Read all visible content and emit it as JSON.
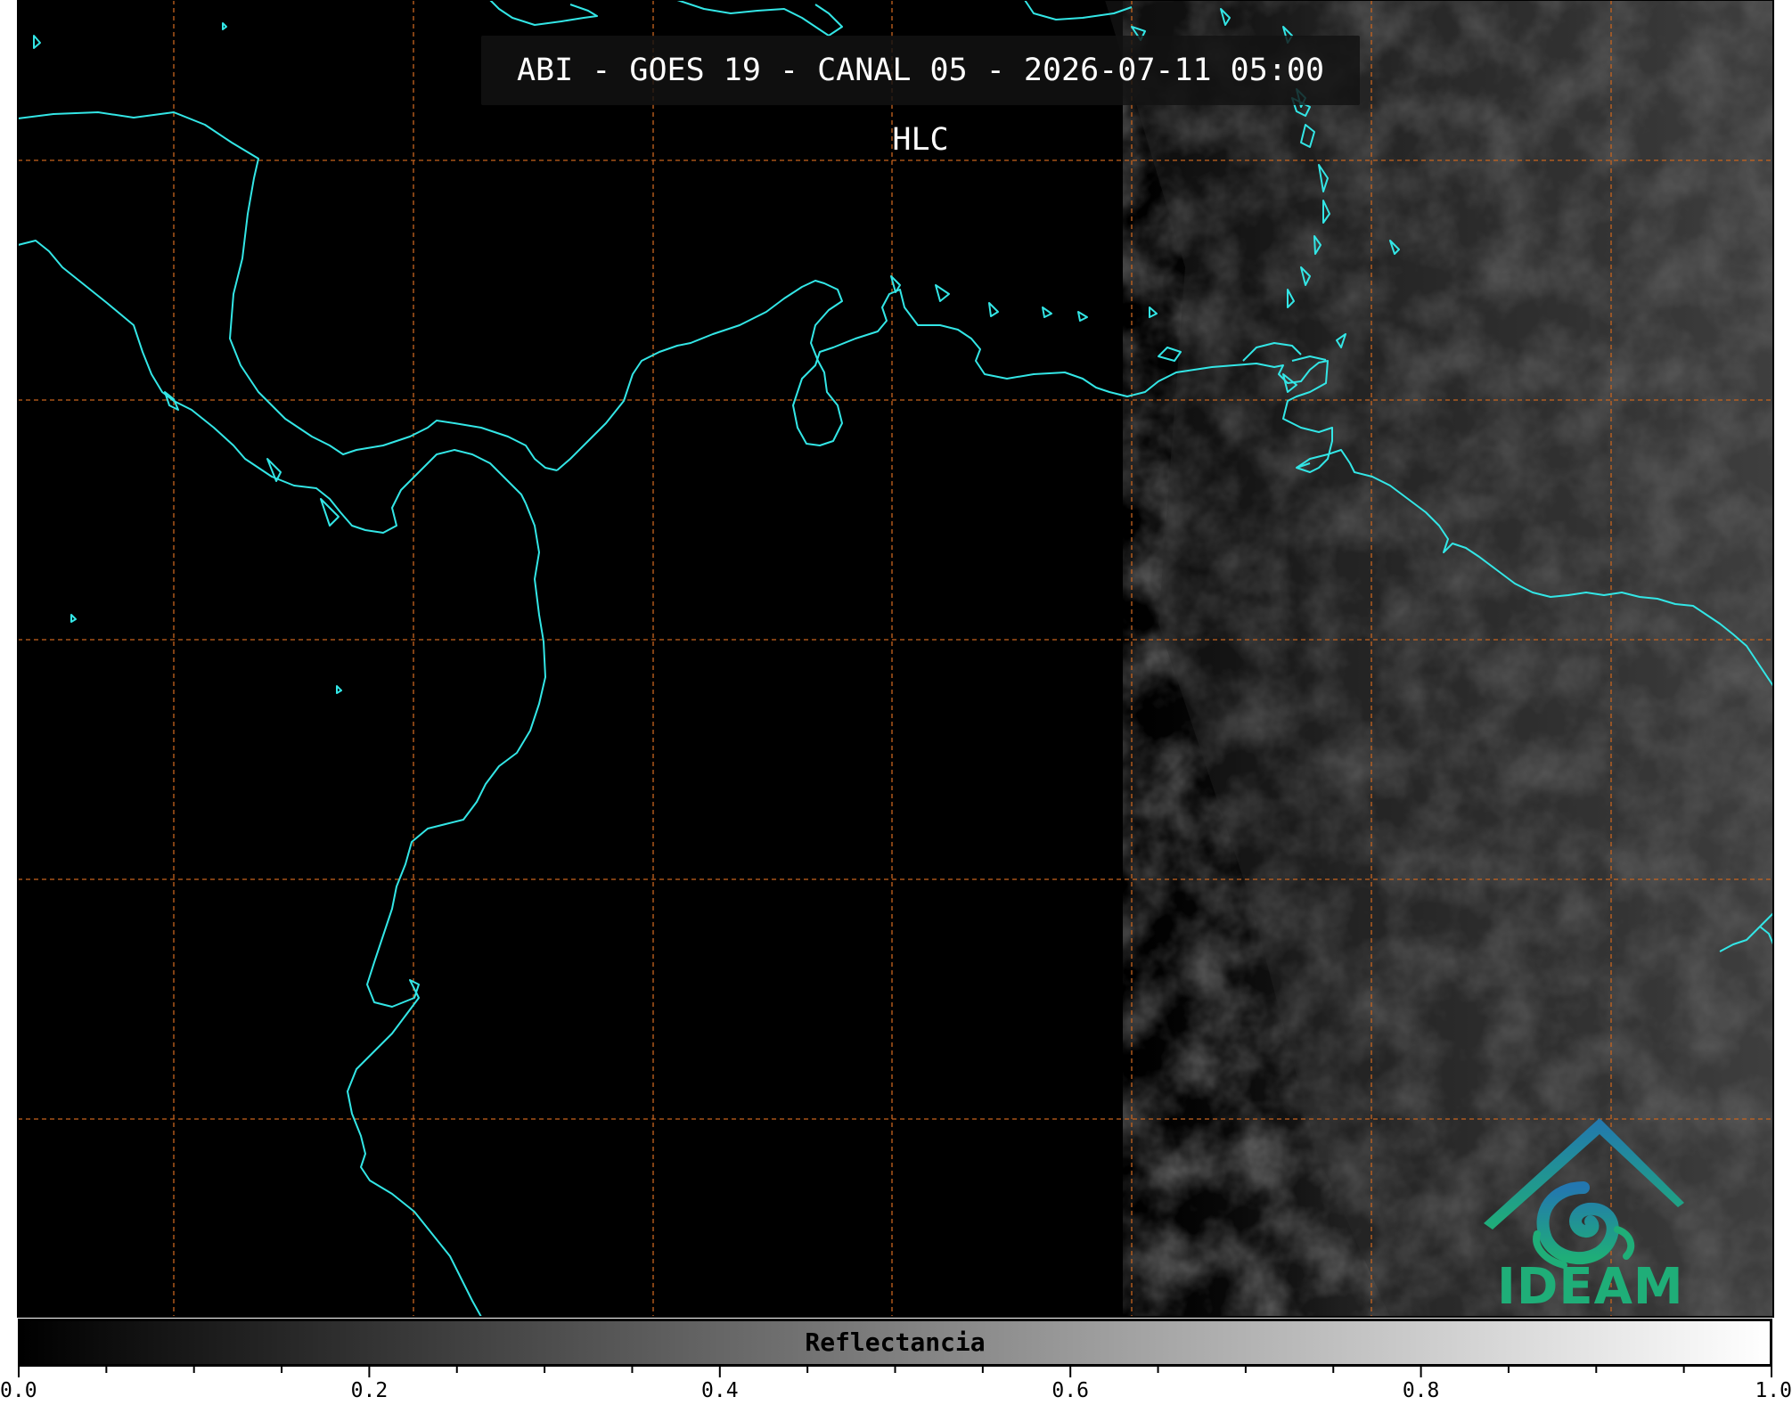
{
  "title": "ABI - GOES 19 - CANAL 05 - 2026-07-11 05:00 HLC",
  "colors": {
    "coastline": "#33e6e6",
    "graticule": "#c8641e",
    "background": "#000000",
    "logo_teal": "#1fae78",
    "logo_blue": "#2377b0"
  },
  "colorbar": {
    "label": "Reflectancia",
    "min": 0.0,
    "max": 1.0,
    "tick_labels": [
      "0.0",
      "0.2",
      "0.4",
      "0.6",
      "0.8",
      "1.0"
    ],
    "colormap": "gray"
  },
  "logo": {
    "text": "IDEAM"
  }
}
